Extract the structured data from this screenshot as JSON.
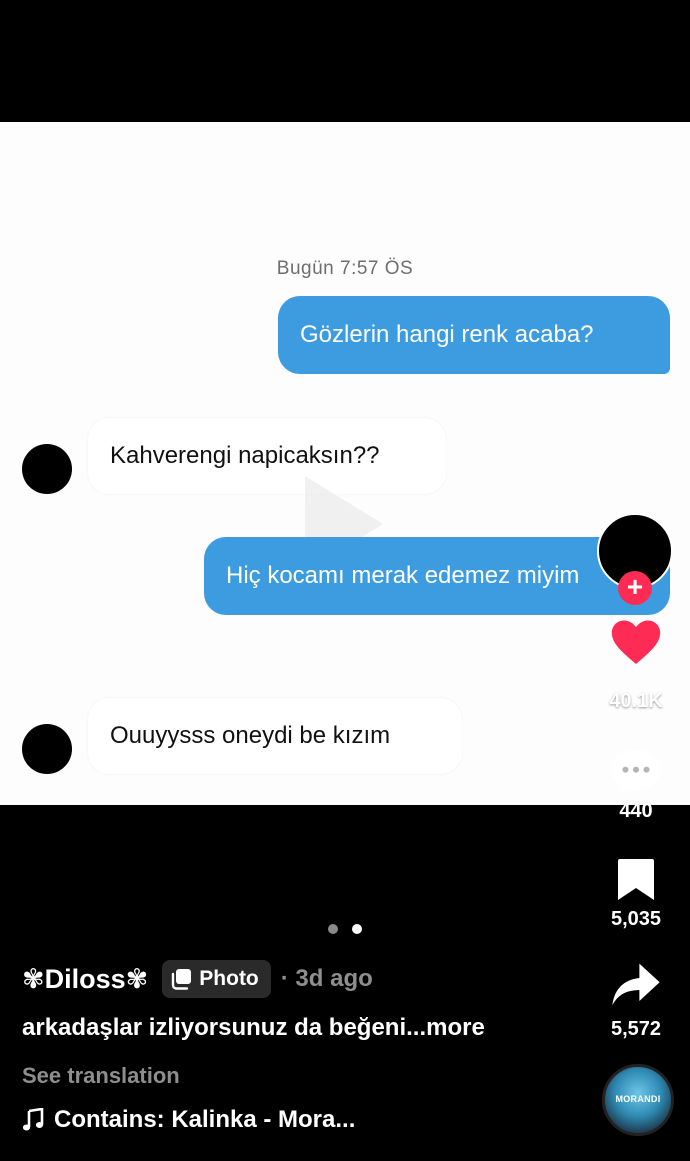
{
  "chat": {
    "timestamp": "Bugün 7:57 ÖS",
    "messages": [
      {
        "side": "out",
        "text": "Gözlerin hangi renk acaba?"
      },
      {
        "side": "in",
        "text": "Kahverengi napicaksın??"
      },
      {
        "side": "out",
        "text": "Hiç kocamı merak edemez miyim"
      },
      {
        "side": "in",
        "text": "Ouuyysss oneydi be kızım"
      }
    ]
  },
  "actions": {
    "follow_glyph": "+",
    "likes": "40.1K",
    "comments": "440",
    "saves": "5,035",
    "shares": "5,572"
  },
  "carousel": {
    "count": 2,
    "active": 2
  },
  "post": {
    "username": "✾Diloss✾",
    "type_badge": "Photo",
    "time_ago": "· 3d ago",
    "caption": "arkadaşlar izliyorsunuz da beğeni...",
    "caption_more": "more",
    "see_translation": "See translation",
    "music": "Contains: Kalinka - Mora..."
  },
  "disc": {
    "label": "MORANDI"
  },
  "colors": {
    "like_red": "#fe2c55",
    "bubble_blue": "#3d9be0"
  },
  "icons": [
    "heart-icon",
    "comment-icon",
    "bookmark-icon",
    "share-icon",
    "music-note-icon",
    "photo-icon"
  ]
}
